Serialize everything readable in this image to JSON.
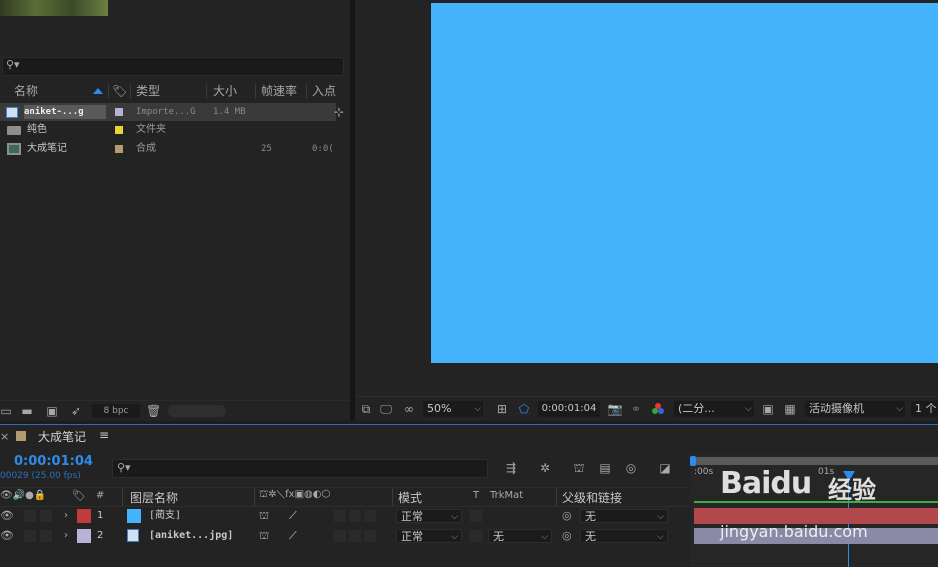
{
  "project": {
    "thumb_text": "",
    "search_placeholder": "",
    "columns": {
      "name": "名称",
      "type": "类型",
      "size": "大小",
      "fps": "帧速率",
      "in": "入点"
    },
    "items": [
      {
        "name": "aniket-...g",
        "type": "Importe...G",
        "size": "1.4 MB",
        "fps": "",
        "in": "",
        "tag_color": "#b7b3d8"
      },
      {
        "name": "纯色",
        "type": "文件夹",
        "size": "",
        "fps": "",
        "in": "",
        "tag_color": "#e8d33a"
      },
      {
        "name": "大成笔记",
        "type": "合成",
        "size": "",
        "fps": "25",
        "in": "0:0(",
        "tag_color": "#b59a72"
      }
    ],
    "bpc": "8 bpc"
  },
  "viewer": {
    "zoom": "50%",
    "timecode": "0:00:01:04",
    "resolution": "(二分...",
    "camera": "活动摄像机",
    "views": "1 个",
    "canvas_color": "#45b3fc"
  },
  "timeline": {
    "comp_name": "大成笔记",
    "menu_icon": "≡",
    "timecode": "0:00:01:04",
    "frame_info": "00029 (25.00 fps)",
    "headers": {
      "num": "#",
      "layer_name": "图层名称",
      "mode": "模式",
      "t": "T",
      "trkmat": "TrkMat",
      "parent": "父级和链接"
    },
    "layers": [
      {
        "num": "1",
        "name": "[蔺支]",
        "label_color": "#c23b3b",
        "mode": "正常",
        "trkmat": "",
        "parent": "无",
        "bar_color": "#b0484c"
      },
      {
        "num": "2",
        "name": "[aniket...jpg]",
        "label_color": "#b7b3d8",
        "mode": "正常",
        "trkmat": "无",
        "parent": "无",
        "bar_color": "#8b8aa6"
      }
    ],
    "ruler": {
      "t0": ":00s",
      "t1": "01s"
    }
  },
  "watermark": {
    "brand": "Baidu",
    "cn": "经验",
    "url": "jingyan.baidu.com"
  }
}
